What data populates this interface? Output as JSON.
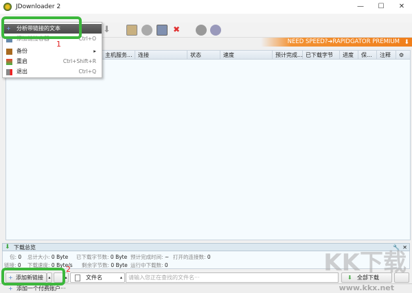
{
  "window": {
    "title": "JDownloader 2"
  },
  "banner": {
    "text": "NEED SPEED?➔RAPIDGATOR PREMIUM"
  },
  "table": {
    "columns": [
      "主机服务...",
      "连接",
      "状态",
      "速度",
      "预计完成...",
      "已下载字节",
      "进度",
      "保...",
      "注释"
    ]
  },
  "menu": {
    "items": [
      {
        "label": "分析带链接的文本",
        "shortcut": ""
      },
      {
        "label": "添加链接容器",
        "shortcut": "Ctrl+O"
      },
      {
        "label": "备份",
        "shortcut": ""
      },
      {
        "label": "重启",
        "shortcut": "Ctrl+Shift+R"
      },
      {
        "label": "退出",
        "shortcut": "Ctrl+Q"
      }
    ]
  },
  "overview": {
    "title": "下载总览",
    "row1": [
      {
        "label": "包:",
        "value": "0"
      },
      {
        "label": "总计大小:",
        "value": "0 Byte"
      },
      {
        "label": "已下载字节数:",
        "value": "0 Byte"
      },
      {
        "label": "预计完成时间:",
        "value": "~"
      },
      {
        "label": "打开的连接数:",
        "value": "0"
      }
    ],
    "row2": [
      {
        "label": "链接:",
        "value": "0"
      },
      {
        "label": "下载速度:",
        "value": "0 Byte/s"
      },
      {
        "label": "剩余字节数:",
        "value": "0 Byte"
      },
      {
        "label": "运行中下载数:",
        "value": "0"
      }
    ]
  },
  "bottom": {
    "add_links": "添加新链接",
    "filter_column": "文件名",
    "search_placeholder": "请输入您正在查找的文件名···",
    "start_all": "全部下载"
  },
  "status": {
    "add_premium": "添加一个付费账户···"
  },
  "annotations": {
    "one": "1",
    "two": "2"
  },
  "watermark": {
    "logo": "KK下载",
    "url": "www.kkx.net"
  }
}
